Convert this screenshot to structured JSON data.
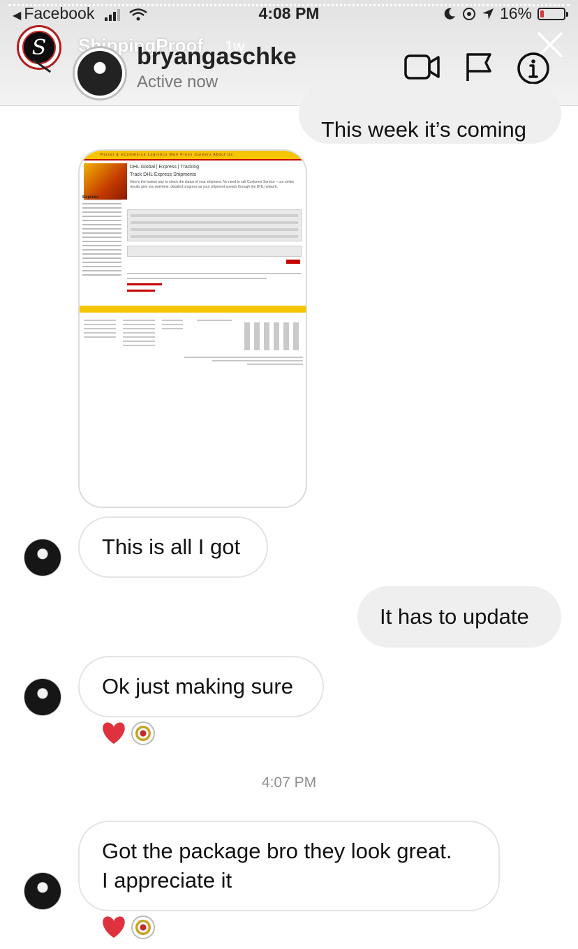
{
  "status_bar": {
    "back_app": "Facebook",
    "time": "4:08 PM",
    "battery": "16%"
  },
  "story": {
    "username": "ShippingProof",
    "age": "1w"
  },
  "chat_header": {
    "name": "bryangaschke",
    "status": "Active now"
  },
  "attachment": {
    "page_title": "DHL Global | Express | Tracking",
    "page_subtitle": "Track DHL Express Shipments",
    "page_intro": "Here's the fastest way to check the status of your shipment. No need to call Customer Service – our online results give you real-time, detailed progress as your shipment speeds through the DHL network.",
    "sidebar_heading": "Express",
    "nav": "Parcel & eCommerce   Logistics   Mail   Press   Careers   About Us"
  },
  "messages": [
    {
      "id": "m1",
      "direction": "outgoing",
      "text": "This week it’s coming"
    },
    {
      "id": "m2",
      "direction": "incoming",
      "text": "This is all I got"
    },
    {
      "id": "m3",
      "direction": "outgoing",
      "text": "It has to update"
    },
    {
      "id": "m4",
      "direction": "incoming",
      "text": "Ok just making sure",
      "reactions": [
        "heart-icon",
        "avatar"
      ]
    },
    {
      "id": "m5",
      "direction": "incoming",
      "lines": [
        "Got the package bro they look great.",
        "I appreciate it"
      ],
      "reactions": [
        "heart-icon",
        "avatar"
      ]
    }
  ],
  "timestamp": "4:07 PM",
  "colors": {
    "outgoing_bubble": "#efefef",
    "incoming_border": "#e4e4e4",
    "heart": "#e0323e",
    "dhl_yellow": "#f5c600",
    "dhl_red": "#c40000"
  }
}
